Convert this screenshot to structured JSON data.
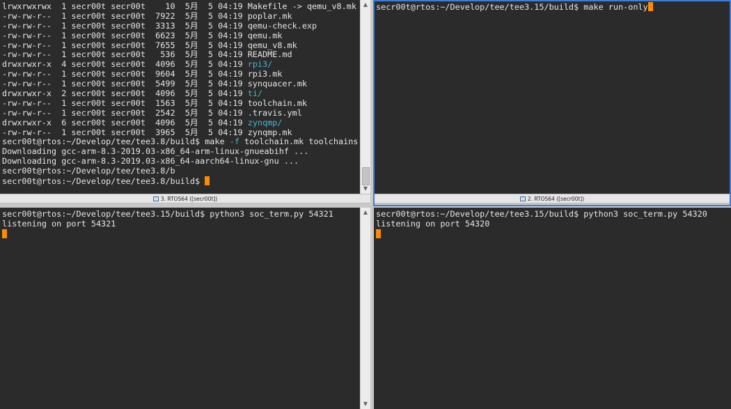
{
  "panes": {
    "top_left": {
      "lines": [
        [
          {
            "t": "lrwxrwxrwx  1 secr00t secr00t    10  5月  5 04:19 "
          },
          {
            "t": "Makefile -> qemu_v8.mk",
            "c": "w"
          }
        ],
        [
          {
            "t": "-rw-rw-r--  1 secr00t secr00t  7922  5月  5 04:19 poplar.mk"
          }
        ],
        [
          {
            "t": "-rw-rw-r--  1 secr00t secr00t  3313  5月  5 04:19 qemu-check.exp"
          }
        ],
        [
          {
            "t": "-rw-rw-r--  1 secr00t secr00t  6623  5月  5 04:19 qemu.mk"
          }
        ],
        [
          {
            "t": "-rw-rw-r--  1 secr00t secr00t  7655  5月  5 04:19 qemu_v8.mk"
          }
        ],
        [
          {
            "t": "-rw-rw-r--  1 secr00t secr00t   536  5月  5 04:19 README.md"
          }
        ],
        [
          {
            "t": "drwxrwxr-x  4 secr00t secr00t  4096  5月  5 04:19 "
          },
          {
            "t": "rpi3/",
            "c": "cyan"
          }
        ],
        [
          {
            "t": "-rw-rw-r--  1 secr00t secr00t  9604  5月  5 04:19 rpi3.mk"
          }
        ],
        [
          {
            "t": "-rw-rw-r--  1 secr00t secr00t  5499  5月  5 04:19 synquacer.mk"
          }
        ],
        [
          {
            "t": "drwxrwxr-x  2 secr00t secr00t  4096  5月  5 04:19 "
          },
          {
            "t": "ti/",
            "c": "cyan"
          }
        ],
        [
          {
            "t": "-rw-rw-r--  1 secr00t secr00t  1563  5月  5 04:19 toolchain.mk"
          }
        ],
        [
          {
            "t": "-rw-rw-r--  1 secr00t secr00t  2542  5月  5 04:19 .travis.yml"
          }
        ],
        [
          {
            "t": "drwxrwxr-x  6 secr00t secr00t  4096  5月  5 04:19 "
          },
          {
            "t": "zynqmp/",
            "c": "cyan"
          }
        ],
        [
          {
            "t": "-rw-rw-r--  1 secr00t secr00t  3965  5月  5 04:19 zynqmp.mk"
          }
        ],
        [
          {
            "t": "secr00t@rtos:~/Develop/tee/tee3.8/build$ make "
          },
          {
            "t": "-f",
            "c": "cyan"
          },
          {
            "t": " toolchain.mk toolchains"
          }
        ],
        [
          {
            "t": "Downloading gcc-arm-8.3-2019.03-x86_64-arm-linux-gnueabihf ..."
          }
        ],
        [
          {
            "t": "Downloading gcc-arm-8.3-2019.03-x86_64-aarch64-linux-gnu ..."
          }
        ],
        [
          {
            "t": "secr00t@rtos:~/Develop/tee/tee3.8/b"
          }
        ],
        [
          {
            "t": "secr00t@rtos:~/Develop/tee/tee3.8/build$ "
          },
          {
            "cursor": true
          }
        ]
      ],
      "status": "3. RTOS64 ([secr00t])"
    },
    "top_right": {
      "lines": [
        [
          {
            "t": "secr00t@rtos:~/Develop/tee/tee3.15/build$ make run-only"
          },
          {
            "cursor": true
          }
        ]
      ],
      "status": "2. RTOS64 ([secr00t])"
    },
    "bottom_left": {
      "lines": [
        [
          {
            "t": "secr00t@rtos:~/Develop/tee/tee3.15/build$ python3 soc_term.py 54321"
          }
        ],
        [
          {
            "t": "listening on port 54321"
          }
        ],
        [
          {
            "cursor": true
          }
        ]
      ]
    },
    "bottom_right": {
      "lines": [
        [
          {
            "t": "secr00t@rtos:~/Develop/tee/tee3.15/build$ python3 soc_term.py 54320"
          }
        ],
        [
          {
            "t": "listening on port 54320"
          }
        ],
        [
          {
            "cursor": true
          }
        ]
      ]
    }
  },
  "icons": {
    "scroll_up": "scroll-up-arrow-icon",
    "scroll_down": "scroll-down-arrow-icon",
    "terminal": "terminal-icon"
  },
  "colors": {
    "background": "#2b2b2b",
    "text": "#e6e6e6",
    "directory": "#45b7d6",
    "cursor": "#ff8c00",
    "active_border": "#3b7ed8"
  }
}
